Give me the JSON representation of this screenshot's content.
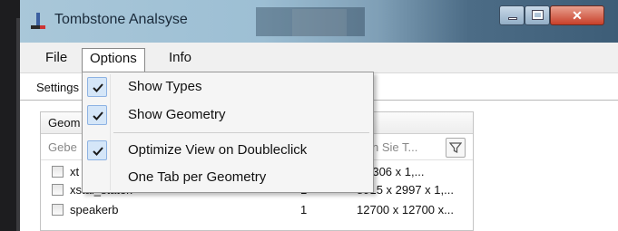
{
  "window": {
    "title": "Tombstone Analsyse",
    "controls": {
      "minimize": "minimize-icon",
      "maximize": "maximize-icon",
      "close": "close-icon"
    }
  },
  "menubar": {
    "items": [
      "File",
      "Options",
      "Info"
    ],
    "active": "Options"
  },
  "tabs": {
    "settings_label": "Settings"
  },
  "geometry_group": {
    "header": "Geom",
    "filter_left_placeholder": "Gebe",
    "filter_right_placeholder": "n Sie T...",
    "rows": [
      {
        "name": "xt",
        "count": "",
        "size": "x 8306 x 1,..."
      },
      {
        "name": "xstal_statek",
        "count": "1",
        "size": "8915 x 2997 x 1,..."
      },
      {
        "name": "speakerb",
        "count": "1",
        "size": "12700 x 12700 x..."
      }
    ]
  },
  "options_menu": {
    "items": [
      {
        "label": "Show Types",
        "checked": true
      },
      {
        "label": "Show Geometry",
        "checked": true
      },
      {
        "label": "Optimize View on Doubleclick",
        "checked": true
      },
      {
        "label": "One Tab per Geometry",
        "checked": false
      }
    ]
  },
  "colors": {
    "accent_check_bg": "#d5e6f8",
    "accent_check_border": "#8db2e3",
    "close_button": "#c8402a",
    "titlebar_start": "#a9c7d9",
    "titlebar_end": "#3d5d77"
  }
}
